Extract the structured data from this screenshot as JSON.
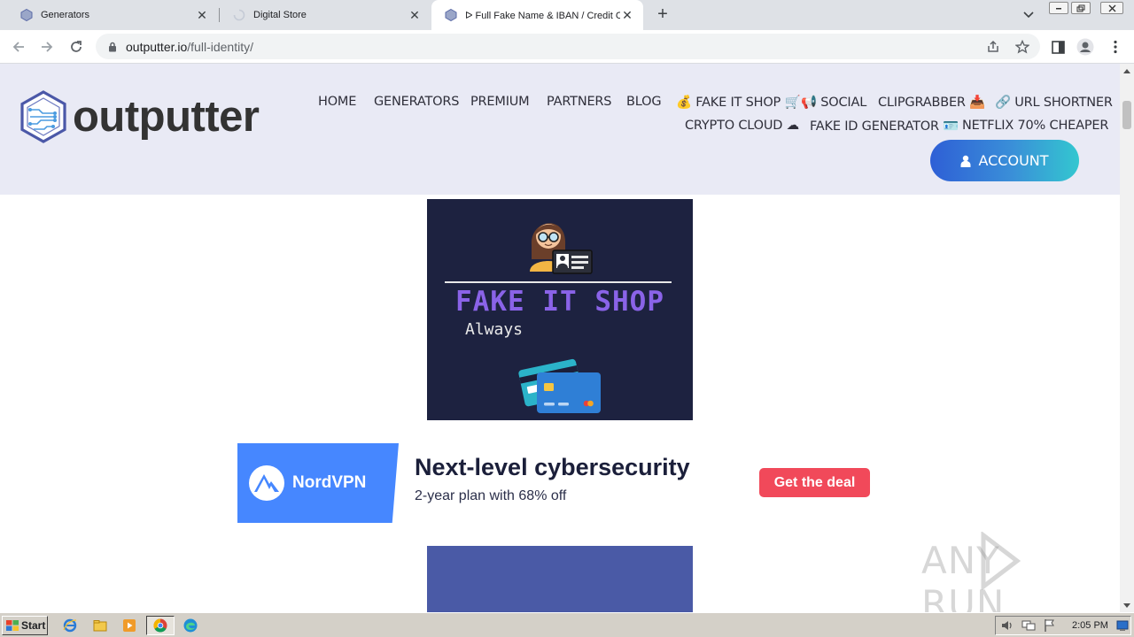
{
  "browser": {
    "tabs": [
      {
        "title": "Generators",
        "active": false
      },
      {
        "title": "Digital Store",
        "active": false,
        "loading": true
      },
      {
        "title": "ᐅ Full Fake Name & IBAN / Credit Ca",
        "active": true
      }
    ],
    "url_host": "outputter.io",
    "url_path": "/full-identity/"
  },
  "site": {
    "logo_text": "outputter",
    "nav": {
      "home": "HOME",
      "generators": "GENERATORS",
      "premium": "PREMIUM",
      "partners": "PARTNERS",
      "blog": "BLOG",
      "fake_it_shop": "💰 FAKE IT SHOP 🛒",
      "social": "📢 SOCIAL",
      "clipgrabber": "CLIPGRABBER 📥",
      "url_shortner": "🔗 URL SHORTNER",
      "crypto_cloud": "CRYPTO CLOUD ☁",
      "fake_id_generator": "FAKE ID GENERATOR 🪪",
      "netflix": "NETFLIX 70% CHEAPER"
    },
    "account_label": "ACCOUNT",
    "colors": {
      "header_bg": "#e9eaf5",
      "account_gradient_start": "#2e5fd6",
      "account_gradient_end": "#33c7d0"
    }
  },
  "ads": {
    "fake_it_shop": {
      "headline": "FAKE IT SHOP",
      "subline": "Always"
    },
    "nordvpn": {
      "brand": "NordVPN",
      "headline": "Next-level cybersecurity",
      "subline": "2-year plan with 68% off",
      "cta": "Get the deal"
    }
  },
  "watermark": "ANY RUN",
  "taskbar": {
    "start_label": "Start",
    "clock": "2:05 PM"
  }
}
